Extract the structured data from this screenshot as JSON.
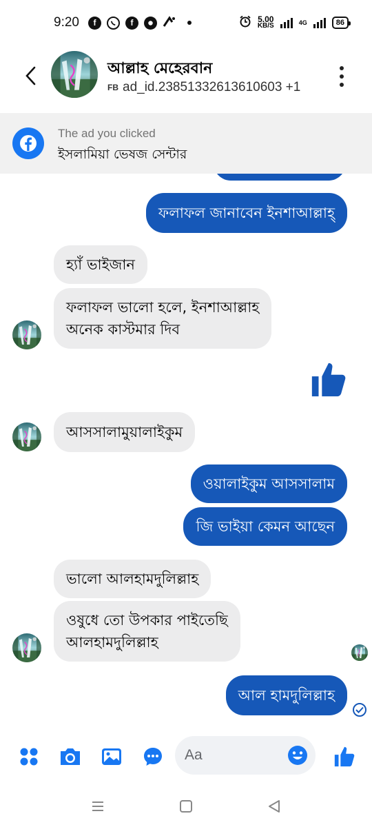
{
  "status_bar": {
    "time": "9:20",
    "app_icons": [
      "f",
      "",
      "f",
      "",
      ""
    ],
    "net_speed_value": "5.00",
    "net_speed_unit": "KB/S",
    "network_label": "4G",
    "battery": "86"
  },
  "header": {
    "contact_name": "আল্লাহ মেহেরবান",
    "source_tag": "FB",
    "subtitle": "ad_id.23851332613610603 +1"
  },
  "ad_banner": {
    "caption": "The ad you clicked",
    "title": "ইসলামিয়া ভেষজ সেন্টার"
  },
  "messages": [
    {
      "direction": "out",
      "text": "ফলাফল জানাবেন ইনশাআল্লাহ্"
    },
    {
      "direction": "in",
      "text": "হ্যাঁ ভাইজান"
    },
    {
      "direction": "in",
      "text": "ফলাফল ভালো হলে, ইনশাআল্লাহ\nঅনেক কাস্টমার দিব"
    },
    {
      "direction": "out",
      "type": "like"
    },
    {
      "direction": "in",
      "text": "আসসালামুয়ালাইকুম"
    },
    {
      "direction": "out",
      "text": "ওয়ালাইকুম আসসালাম"
    },
    {
      "direction": "out",
      "text": "জি ভাইয়া কেমন আছেন"
    },
    {
      "direction": "in",
      "text": "ভালো আলহামদুলিল্লাহ"
    },
    {
      "direction": "in",
      "text": "ওষুধে তো উপকার পাইতেছি\nআলহামদুলিল্লাহ"
    },
    {
      "direction": "out",
      "text": "আল হামদুলিল্লাহ"
    }
  ],
  "composer": {
    "placeholder": "Aa"
  },
  "colors": {
    "outgoing_bubble": "#1658b8",
    "incoming_bubble": "#ececed",
    "accent": "#1877f2"
  },
  "icons": [
    "back-arrow-icon",
    "more-vertical-icon",
    "facebook-icon",
    "like-icon",
    "menu-dots-icon",
    "camera-icon",
    "image-icon",
    "chat-bubble-icon",
    "emoji-icon",
    "nav-recents-icon",
    "nav-home-icon",
    "nav-back-icon",
    "seen-check-icon"
  ]
}
